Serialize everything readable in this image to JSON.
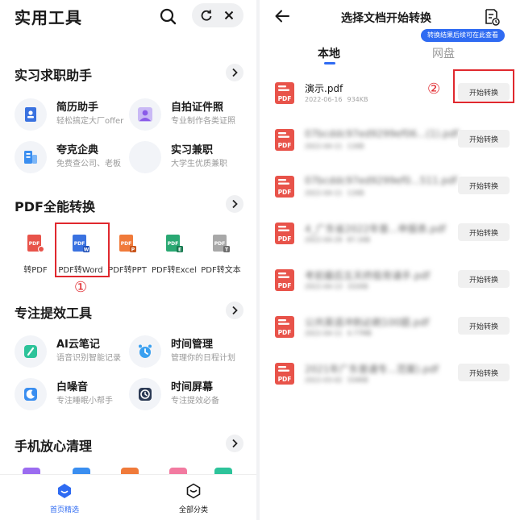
{
  "left": {
    "app_title": "实用工具",
    "sections": [
      {
        "title": "实习求职助手"
      },
      {
        "title": "PDF全能转换"
      },
      {
        "title": "专注提效工具"
      },
      {
        "title": "手机放心清理"
      }
    ],
    "job_tools": [
      {
        "name": "简历助手",
        "desc": "轻松搞定大厂offer",
        "icon": "resume-icon"
      },
      {
        "name": "自拍证件照",
        "desc": "专业制作各类证照",
        "icon": "id-photo-icon"
      },
      {
        "name": "夸克企典",
        "desc": "免费查公司、老板",
        "icon": "enterprise-icon"
      },
      {
        "name": "实习兼职",
        "desc": "大学生优质兼职",
        "icon": "part-time-icon"
      }
    ],
    "pdf_tools": [
      {
        "label": "转PDF",
        "color": "#e8534a"
      },
      {
        "label": "PDF转Word",
        "color": "#3a72e0"
      },
      {
        "label": "PDF转PPT",
        "color": "#f07a3a"
      },
      {
        "label": "PDF转Excel",
        "color": "#2aa873"
      },
      {
        "label": "PDF转文本",
        "color": "#8a8a8a"
      }
    ],
    "focus_tools": [
      {
        "name": "AI云笔记",
        "desc": "语音识别智能记录",
        "icon": "note-icon"
      },
      {
        "name": "时间管理",
        "desc": "管理你的日程计划",
        "icon": "alarm-icon"
      },
      {
        "name": "白噪音",
        "desc": "专注睡眠小帮手",
        "icon": "moon-icon"
      },
      {
        "name": "时间屏幕",
        "desc": "专注提效必备",
        "icon": "clock-screen-icon"
      }
    ],
    "annotation_1": "①",
    "bottom_nav": [
      {
        "label": "首页精选",
        "active": true
      },
      {
        "label": "全部分类",
        "active": false
      }
    ]
  },
  "right": {
    "title": "选择文档开始转换",
    "tooltip": "转换结果后续可在此查看",
    "tabs": [
      {
        "label": "本地",
        "active": true
      },
      {
        "label": "网盘",
        "active": false
      }
    ],
    "convert_label": "开始转换",
    "annotation_2": "②",
    "files": [
      {
        "name": "演示.pdf",
        "date": "2022-06-16",
        "size": "934KB",
        "blurred": false
      },
      {
        "name": "07bcddc97ed9299ef06...(1).pdf",
        "date": "2022-04-11",
        "size": "11KB",
        "blurred": true
      },
      {
        "name": "07bcddc97ed9299ef0...511.pdf",
        "date": "2022-04-11",
        "size": "11KB",
        "blurred": true
      },
      {
        "name": "4_广东省2022年普...申报表.pdf",
        "date": "2022-04-29",
        "size": "87.1KB",
        "blurred": true
      },
      {
        "name": "考前最后五天终极背诵手.pdf",
        "date": "2022-04-13",
        "size": "332KB",
        "blurred": true
      },
      {
        "name": "公共英语冲刺必刷100题.pdf",
        "date": "2022-04-11",
        "size": "4.77MB",
        "blurred": true
      },
      {
        "name": "2021年广东普通专...范案).pdf",
        "date": "2022-03-02",
        "size": "334KB",
        "blurred": true
      }
    ]
  },
  "colors": {
    "accent": "#2f6bf2",
    "annotation": "#e0282e",
    "pdf_red": "#e8534a"
  }
}
